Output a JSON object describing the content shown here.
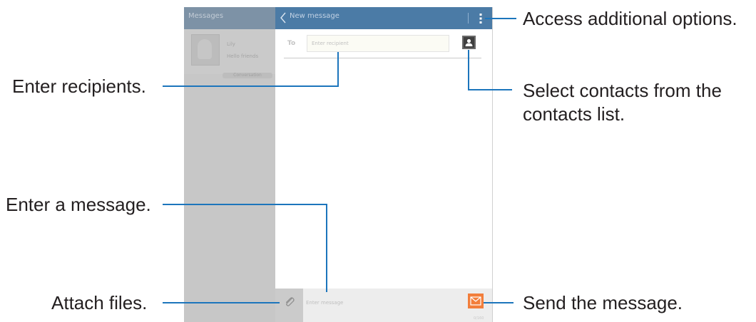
{
  "left_pane": {
    "header_title": "Messages",
    "contact_name": "Lily",
    "contact_detail": "Hello friends",
    "contact_action": "Conversation"
  },
  "header": {
    "title": "New message"
  },
  "recipient": {
    "to_label": "To",
    "placeholder": "Enter recipient"
  },
  "compose": {
    "placeholder": "Enter message",
    "counter": "0/160"
  },
  "callouts": {
    "options": "Access additional options.",
    "recipients": "Enter recipients.",
    "contacts_line1": "Select contacts from the",
    "contacts_line2": "contacts list.",
    "message": "Enter a message.",
    "attach": "Attach files.",
    "send": "Send the message."
  },
  "colors": {
    "header_blue": "#4b7ba6",
    "callout_blue": "#1c75bc",
    "send_orange": "#f27e3b"
  },
  "icons": [
    "back-icon",
    "more-options-icon",
    "contacts-icon",
    "attach-icon",
    "send-icon"
  ]
}
